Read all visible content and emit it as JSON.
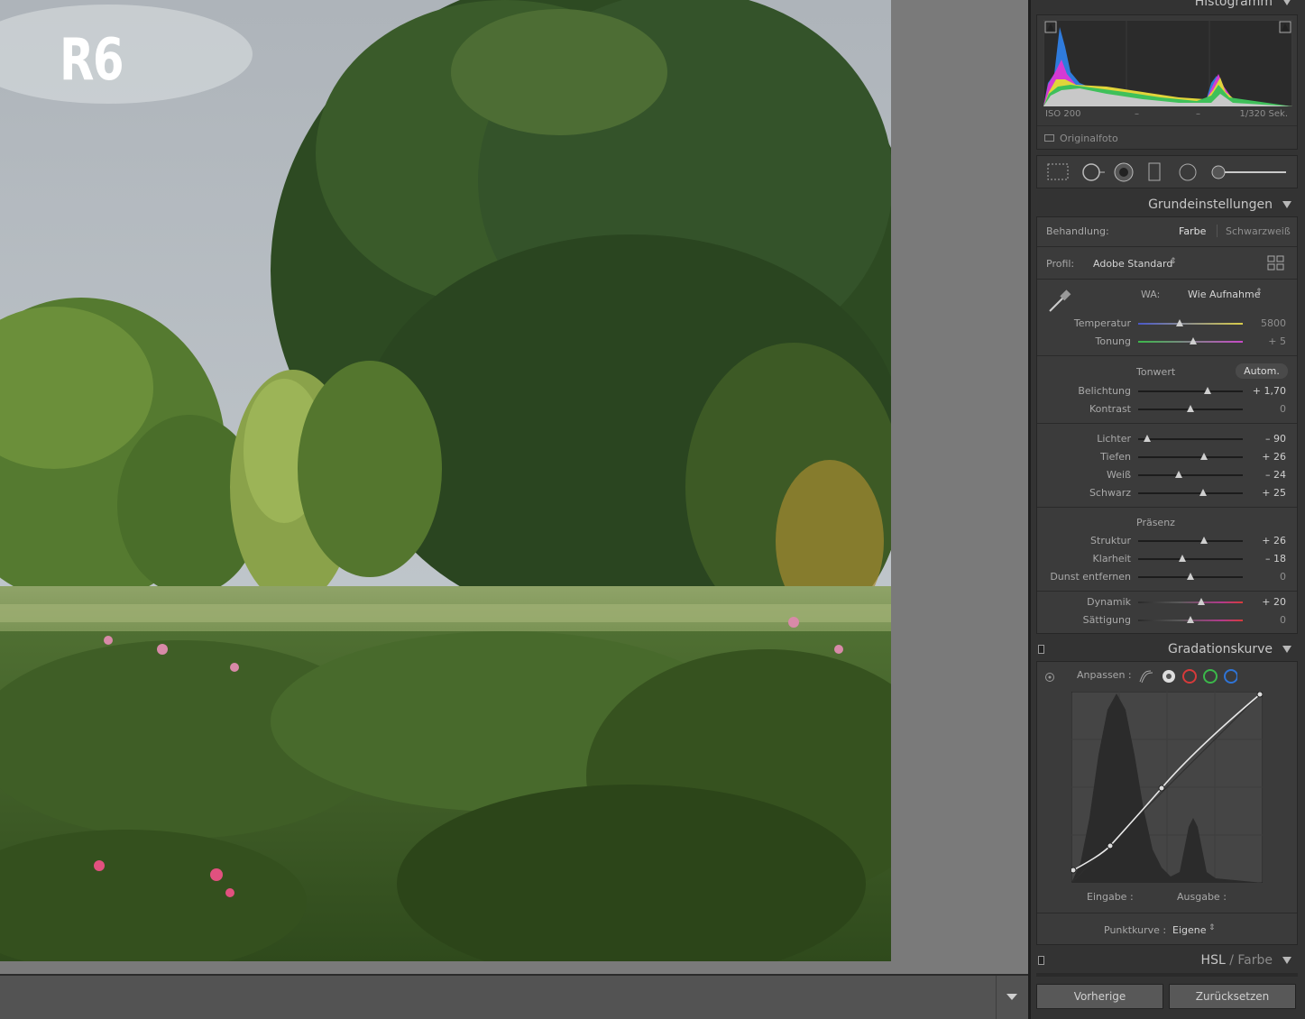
{
  "photo": {
    "watermark": "R6"
  },
  "histogram": {
    "title": "Histogramm",
    "iso": "ISO 200",
    "dash1": "–",
    "dash2": "–",
    "shutter": "1/320 Sek.",
    "original_label": "Originalfoto"
  },
  "tools": {
    "icons": [
      "crop-grid-icon",
      "spot-removal-icon",
      "red-eye-icon",
      "graduated-filter-icon",
      "radial-filter-icon",
      "brush-slider-icon"
    ]
  },
  "basic": {
    "title": "Grundeinstellungen",
    "treatment_label": "Behandlung:",
    "treatment_color": "Farbe",
    "treatment_bw": "Schwarzweiß",
    "profile_label": "Profil:",
    "profile_value": "Adobe Standard",
    "wb_label": "WA:",
    "wb_value": "Wie Aufnahme",
    "temp": {
      "label": "Temperatur",
      "value": "5800",
      "position": 0.4
    },
    "tint": {
      "label": "Tonung",
      "value": "+ 5",
      "position": 0.53
    },
    "tone_label": "Tonwert",
    "auto_label": "Autom.",
    "exposure": {
      "label": "Belichtung",
      "value": "+ 1,70",
      "position": 0.66
    },
    "contrast": {
      "label": "Kontrast",
      "value": "0",
      "position": 0.5
    },
    "highlights": {
      "label": "Lichter",
      "value": "– 90",
      "position": 0.05
    },
    "shadows": {
      "label": "Tiefen",
      "value": "+ 26",
      "position": 0.63
    },
    "whites": {
      "label": "Weiß",
      "value": "– 24",
      "position": 0.38
    },
    "blacks": {
      "label": "Schwarz",
      "value": "+ 25",
      "position": 0.62
    },
    "presence_label": "Präsenz",
    "texture": {
      "label": "Struktur",
      "value": "+ 26",
      "position": 0.63
    },
    "clarity": {
      "label": "Klarheit",
      "value": "– 18",
      "position": 0.41
    },
    "dehaze": {
      "label": "Dunst entfernen",
      "value": "0",
      "position": 0.5
    },
    "vibrance": {
      "label": "Dynamik",
      "value": "+ 20",
      "position": 0.6
    },
    "saturation": {
      "label": "Sättigung",
      "value": "0",
      "position": 0.5
    }
  },
  "curve": {
    "title": "Gradationskurve",
    "adjust_label": "Anpassen :",
    "input_label": "Eingabe :",
    "output_label": "Ausgabe :",
    "pointcurve_label": "Punktkurve :",
    "pointcurve_value": "Eigene"
  },
  "hsl": {
    "title": "HSL",
    "sep": "/",
    "sub": "Farbe"
  },
  "buttons": {
    "previous": "Vorherige",
    "reset": "Zurücksetzen"
  },
  "colors": {
    "panel": "#333333",
    "box": "#3b3b3b",
    "accent_red": "#d63a3a",
    "accent_green": "#3bb84a",
    "accent_blue": "#2f74d6"
  }
}
